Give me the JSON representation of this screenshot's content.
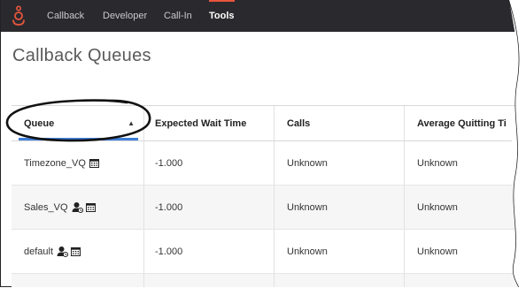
{
  "nav": {
    "items": [
      {
        "label": "Callback",
        "active": false
      },
      {
        "label": "Developer",
        "active": false
      },
      {
        "label": "Call-In",
        "active": false
      },
      {
        "label": "Tools",
        "active": true
      }
    ],
    "logo_icon": "genesys-logo-icon",
    "active_color": "#e8553d",
    "bar_color": "#2a2a2e"
  },
  "page": {
    "title": "Callback Queues"
  },
  "table": {
    "columns": [
      {
        "label": "Queue",
        "sort": "ascending",
        "sort_indicator": "▲"
      },
      {
        "label": "Expected Wait Time"
      },
      {
        "label": "Calls"
      },
      {
        "label": "Average Quitting Ti"
      }
    ],
    "rows": [
      {
        "queue": "Timezone_VQ",
        "icons": [
          "calendar-icon"
        ],
        "ewt": "-1.000",
        "calls": "Unknown",
        "aqt": "Unknown"
      },
      {
        "queue": "Sales_VQ",
        "icons": [
          "agent-icon",
          "calendar-icon"
        ],
        "ewt": "-1.000",
        "calls": "Unknown",
        "aqt": "Unknown"
      },
      {
        "queue": "default",
        "icons": [
          "agent-icon",
          "calendar-icon"
        ],
        "ewt": "-1.000",
        "calls": "Unknown",
        "aqt": "Unknown"
      }
    ]
  }
}
